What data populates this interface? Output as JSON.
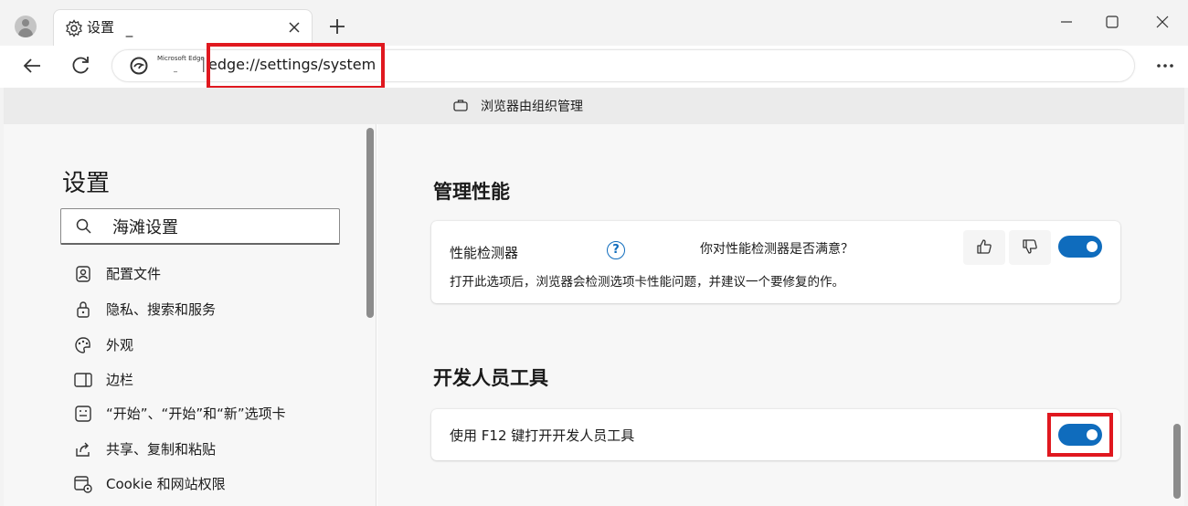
{
  "tab": {
    "title": "设置",
    "title_suffix": "_"
  },
  "address": {
    "site_label": "Microsoft Edge",
    "site_label_suffix": "_",
    "separator": "|",
    "url": "edge://settings/system"
  },
  "banner": {
    "text": "浏览器由组织管理"
  },
  "sidebar": {
    "title": "设置",
    "search_value": "海滩设置",
    "items": [
      {
        "label": "配置文件",
        "icon": "profile-icon"
      },
      {
        "label": "隐私、搜索和服务",
        "icon": "lock-icon"
      },
      {
        "label": "外观",
        "icon": "palette-icon"
      },
      {
        "label": "边栏",
        "icon": "sidebar-icon"
      },
      {
        "label": "“开始”、“开始”和“新”选项卡",
        "icon": "home-tab-icon"
      },
      {
        "label": "共享、复制和粘贴",
        "icon": "share-icon"
      },
      {
        "label": "Cookie 和网站权限",
        "icon": "cookie-permissions-icon"
      }
    ]
  },
  "main": {
    "perf_section_title": "管理性能",
    "perf_detector_label": "性能检测器",
    "help_glyph": "?",
    "feedback_question": "你对性能检测器是否满意？",
    "perf_detector_desc": "打开此选项后，浏览器会检测选项卡性能问题，并建议一个要修复的作。",
    "perf_detector_enabled": true,
    "dev_section_title": "开发人员工具",
    "f12_label": "使用 F12 键打开开发人员工具",
    "f12_enabled": true
  },
  "colors": {
    "accent": "#0f6cbd",
    "highlight": "#e0181f"
  }
}
